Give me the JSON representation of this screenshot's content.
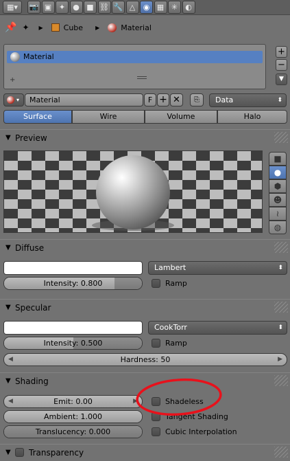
{
  "context_tabs": [
    {
      "icon": "render-camera-icon",
      "glyph": "📷",
      "active": false
    },
    {
      "icon": "render-layers-icon",
      "glyph": "▣",
      "active": false
    },
    {
      "icon": "scene-icon",
      "glyph": "✦",
      "active": false
    },
    {
      "icon": "world-icon",
      "glyph": "●",
      "active": false
    },
    {
      "icon": "object-icon",
      "glyph": "■",
      "active": false
    },
    {
      "icon": "constraints-icon",
      "glyph": "⛓",
      "active": false
    },
    {
      "icon": "modifiers-icon",
      "glyph": "🔧",
      "active": false
    },
    {
      "icon": "data-icon",
      "glyph": "△",
      "active": false
    },
    {
      "icon": "material-icon",
      "glyph": "◉",
      "active": true
    },
    {
      "icon": "texture-icon",
      "glyph": "▦",
      "active": false
    },
    {
      "icon": "particles-icon",
      "glyph": "✳",
      "active": false
    },
    {
      "icon": "physics-icon",
      "glyph": "◐",
      "active": false
    }
  ],
  "breadcrumb": {
    "object": "Cube",
    "material": "Material"
  },
  "slot_list": {
    "selected": "Material"
  },
  "datablock": {
    "name": "Material",
    "fake_user": "F",
    "link": "Data"
  },
  "tabs": [
    "Surface",
    "Wire",
    "Volume",
    "Halo"
  ],
  "active_tab": "Surface",
  "panels": {
    "preview": {
      "title": "Preview"
    },
    "diffuse": {
      "title": "Diffuse",
      "shader": "Lambert",
      "intensity_label": "Intensity: 0.800",
      "intensity_value": 0.8,
      "ramp": "Ramp"
    },
    "specular": {
      "title": "Specular",
      "shader": "CookTorr",
      "intensity_label": "Intensity: 0.500",
      "intensity_value": 0.5,
      "ramp": "Ramp",
      "hardness_label": "Hardness: 50"
    },
    "shading": {
      "title": "Shading",
      "emit": "Emit: 0.00",
      "ambient": "Ambient: 1.000",
      "ambient_value": 1.0,
      "translucency": "Translucency: 0.000",
      "translucency_value": 0.0,
      "shadeless": "Shadeless",
      "tangent": "Tangent Shading",
      "cubic": "Cubic Interpolation"
    },
    "transparency": {
      "title": "Transparency"
    }
  },
  "colors": {
    "accent": "#5680c2",
    "annotation": "#e8111b"
  }
}
